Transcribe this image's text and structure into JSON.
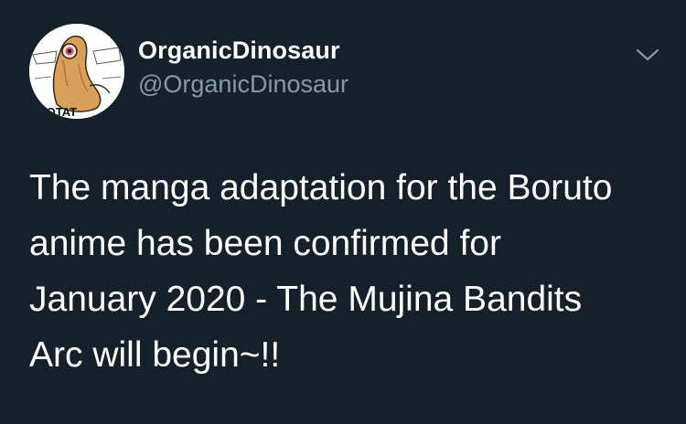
{
  "tweet": {
    "author": {
      "display_name": "OrganicDinosaur",
      "handle": "@OrganicDinosaur",
      "avatar_icon": "avatar-icon",
      "avatar_text": "POTAT"
    },
    "menu_icon": "chevron-down-icon",
    "text": "The manga adaptation for the Boruto\nanime has been confirmed for\nJanuary 2020 - The Mujina Bandits\nArc will begin~!!"
  },
  "colors": {
    "background": "#15202b",
    "primary_text": "#ffffff",
    "secondary_text": "#8899a6"
  }
}
